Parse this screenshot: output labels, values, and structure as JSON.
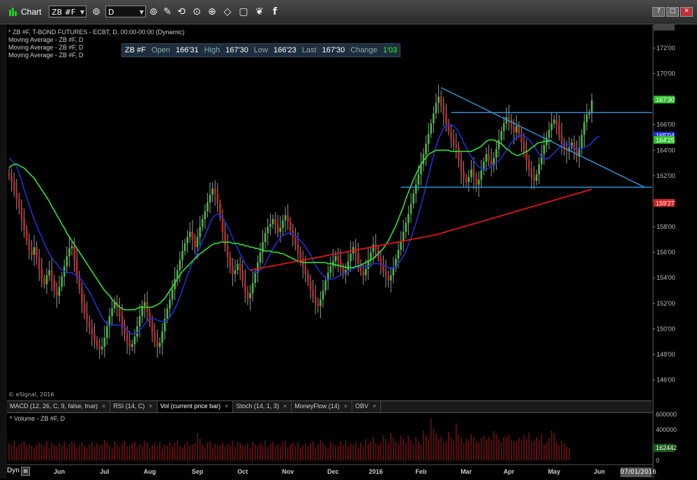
{
  "window": {
    "title": "Chart",
    "symbol": "ZB #F",
    "interval": "D"
  },
  "info_lines": [
    "* ZB #F, T-BOND FUTURES - ECBT, D, 00:00-00:00 (Dynamic)",
    "Moving Average - ZB #F, D",
    "Moving Average - ZB #F, D",
    "Moving Average - ZB #F, D"
  ],
  "quote": {
    "symbol": "ZB #F",
    "open_label": "Open",
    "open": "166'31",
    "high_label": "High",
    "high": "167'30",
    "low_label": "Low",
    "low": "166'23",
    "last_label": "Last",
    "last": "167'30",
    "change_label": "Change",
    "change": "1'03"
  },
  "copyright": "© eSignal, 2016",
  "tabs": [
    {
      "label": "MACD (12, 26, C, 9, false, true)"
    },
    {
      "label": "RSI (14, C)"
    },
    {
      "label": "Vol (current price bar)"
    },
    {
      "label": "Stoch (14, 1, 3)"
    },
    {
      "label": "MoneyFlow (14)"
    },
    {
      "label": "OBV"
    }
  ],
  "volume_label": "* Volume - ZB #F, D",
  "footer": {
    "dyn": "Dyn",
    "date": "07/01/2016"
  },
  "colors": {
    "up": "#3fbf3f",
    "down": "#d02020",
    "ma_fast": "#2030d0",
    "ma_mid": "#30e030",
    "ma_slow": "#e01515",
    "trend": "#2d9ae0",
    "volume": "#5a1010"
  },
  "chart_data": [
    {
      "type": "candlestick",
      "title": "ZB #F, T-BOND FUTURES - ECBT, D",
      "x_ticks": [
        "Jun",
        "Jul",
        "Aug",
        "Sep",
        "Oct",
        "Nov",
        "Dec",
        "2016",
        "Feb",
        "Mar",
        "Apr",
        "May",
        "Jun"
      ],
      "y_ticks": [
        "173'21",
        "172'00",
        "170'00",
        "168'00",
        "166'00",
        "164'00",
        "162'00",
        "160'00",
        "158'00",
        "156'00",
        "154'00",
        "152'00",
        "150'00",
        "148'00",
        "146'00"
      ],
      "ylim": [
        144.5,
        173.8
      ],
      "price_labels": [
        {
          "text": "167'30",
          "value": 167.94,
          "color": "#30c030"
        },
        {
          "text": "165'04",
          "value": 165.125,
          "color": "#2030d0"
        },
        {
          "text": "164'25",
          "value": 164.78,
          "color": "#30c030"
        },
        {
          "text": "159'27",
          "value": 159.84,
          "color": "#d02020"
        }
      ],
      "closes": [
        162.0,
        161.5,
        160.8,
        160.2,
        159.5,
        158.6,
        157.8,
        156.9,
        156.2,
        155.8,
        156.4,
        155.6,
        154.7,
        153.9,
        153.5,
        154.2,
        154.6,
        153.8,
        153.0,
        152.6,
        153.3,
        154.1,
        154.9,
        155.7,
        156.3,
        156.5,
        155.4,
        154.2,
        153.1,
        152.0,
        151.2,
        150.6,
        150.1,
        149.6,
        149.1,
        148.7,
        148.4,
        148.6,
        149.3,
        150.2,
        151.0,
        151.6,
        152.1,
        151.7,
        151.0,
        150.3,
        149.6,
        149.0,
        148.6,
        148.8,
        149.4,
        150.2,
        151.0,
        151.8,
        152.1,
        151.3,
        150.5,
        149.7,
        149.0,
        148.6,
        148.9,
        149.8,
        150.8,
        151.6,
        152.3,
        153.1,
        153.9,
        154.6,
        155.4,
        156.1,
        156.7,
        157.2,
        157.6,
        157.0,
        156.4,
        157.2,
        158.0,
        158.6,
        159.2,
        159.9,
        160.5,
        161.0,
        160.6,
        159.8,
        158.8,
        157.6,
        156.5,
        155.6,
        154.9,
        154.3,
        154.6,
        155.1,
        154.6,
        153.7,
        152.9,
        152.4,
        152.8,
        153.6,
        154.4,
        155.2,
        156.0,
        156.8,
        157.5,
        158.0,
        158.2,
        158.6,
        158.2,
        157.6,
        157.9,
        158.5,
        158.9,
        158.4,
        157.7,
        157.2,
        156.6,
        156.0,
        155.5,
        154.9,
        154.3,
        153.7,
        153.1,
        152.5,
        152.0,
        151.8,
        152.3,
        153.0,
        153.8,
        154.4,
        154.9,
        155.3,
        155.7,
        155.4,
        154.8,
        154.3,
        154.6,
        155.3,
        155.9,
        156.4,
        155.9,
        155.1,
        154.5,
        154.2,
        154.7,
        155.4,
        156.0,
        156.6,
        156.2,
        155.6,
        155.0,
        154.5,
        154.1,
        153.8,
        154.2,
        154.8,
        155.5,
        156.2,
        156.9,
        157.6,
        158.3,
        159.0,
        159.8,
        160.6,
        161.3,
        162.1,
        162.9,
        163.7,
        164.5,
        165.3,
        166.1,
        166.9,
        167.7,
        168.2,
        167.5,
        166.8,
        166.1,
        165.5,
        164.9,
        164.4,
        164.2,
        163.2,
        162.3,
        161.8,
        161.5,
        161.9,
        162.5,
        161.8,
        161.3,
        161.7,
        162.4,
        163.1,
        163.7,
        163.2,
        162.8,
        163.4,
        164.1,
        164.8,
        165.5,
        166.1,
        166.6,
        166.4,
        165.8,
        165.4,
        165.9,
        165.3,
        164.6,
        163.9,
        163.2,
        162.5,
        161.9,
        161.6,
        162.1,
        162.9,
        163.7,
        164.4,
        165.0,
        165.6,
        166.1,
        166.4,
        166.0,
        165.2,
        164.5,
        164.1,
        163.9,
        164.2,
        164.6,
        164.0,
        163.5,
        164.2,
        165.2,
        166.2,
        166.8,
        166.9,
        167.9
      ],
      "ma_fast": [
        163.4,
        163.2,
        163.0,
        162.7,
        162.2,
        161.6,
        160.9,
        160.3,
        159.7,
        159.1,
        158.6,
        158.1,
        157.6,
        157.2,
        156.7,
        156.3,
        155.9,
        155.6,
        155.3,
        155.1,
        154.8,
        154.6,
        154.5,
        154.4,
        154.4,
        154.4,
        154.3,
        154.1,
        154.0,
        153.8,
        153.5,
        153.2,
        152.9,
        152.5,
        152.1,
        151.7,
        151.3,
        150.9,
        150.6,
        150.4,
        150.3,
        150.3,
        150.3,
        150.3,
        150.3,
        150.2,
        150.1,
        149.9,
        149.7,
        149.6,
        149.6,
        149.7,
        149.9,
        150.1,
        150.4,
        150.6,
        150.8,
        150.8,
        150.8,
        150.7,
        150.6,
        150.6,
        150.6,
        150.7,
        150.9,
        151.2,
        151.6,
        152.0,
        152.5,
        153.1,
        153.6,
        154.2,
        154.7,
        155.2,
        155.6,
        156.0,
        156.4,
        156.9,
        157.3,
        157.8,
        158.3,
        158.7,
        158.9,
        159.0,
        158.9,
        158.7,
        158.4,
        158.0,
        157.6,
        157.1,
        156.7,
        156.3,
        155.9,
        155.5,
        155.1,
        154.8,
        154.6,
        154.5,
        154.4,
        154.5,
        154.6,
        154.8,
        155.1,
        155.5,
        155.9,
        156.3,
        156.6,
        156.9,
        157.1,
        157.3,
        157.4,
        157.5,
        157.5,
        157.4,
        157.3,
        157.1,
        156.9,
        156.7,
        156.4,
        156.1,
        155.8,
        155.4,
        155.0,
        154.7,
        154.4,
        154.2,
        154.0,
        153.9,
        153.9,
        153.9,
        154.0,
        154.1,
        154.2,
        154.3,
        154.4,
        154.5,
        154.6,
        154.7,
        154.8,
        154.8,
        154.9,
        154.9,
        154.9,
        154.9,
        155.0,
        155.1,
        155.1,
        155.1,
        155.1,
        155.0,
        154.9,
        154.8,
        154.7,
        154.8,
        154.9,
        155.1,
        155.4,
        155.7,
        156.1,
        156.6,
        157.1,
        157.7,
        158.3,
        159.0,
        159.7,
        160.4,
        161.2,
        162.0,
        162.8,
        163.6,
        164.3,
        164.9,
        165.3,
        165.7,
        165.9,
        166.0,
        166.0,
        165.9,
        165.7,
        165.4,
        165.0,
        164.6,
        164.2,
        163.8,
        163.5,
        163.2,
        162.9,
        162.7,
        162.6,
        162.5,
        162.5,
        162.6,
        162.8,
        162.9,
        163.0,
        163.2,
        163.4,
        163.7,
        164.0,
        164.3,
        164.6,
        164.8,
        165.0,
        165.1,
        165.2,
        165.1,
        165.0,
        164.8,
        164.6,
        164.3,
        164.0,
        163.7,
        163.5,
        163.4,
        163.3,
        163.4,
        163.6,
        163.8,
        164.0,
        164.2,
        164.4,
        164.5,
        164.5,
        164.4,
        164.3,
        164.2,
        164.1,
        164.1,
        164.1,
        164.2,
        164.3,
        164.4,
        164.6,
        164.8,
        165.0,
        165.1
      ],
      "ma_mid": [
        162.6,
        162.8,
        162.9,
        162.9,
        162.8,
        162.7,
        162.6,
        162.4,
        162.2,
        162.0,
        161.8,
        161.5,
        161.2,
        160.9,
        160.6,
        160.3,
        160.0,
        159.6,
        159.3,
        158.9,
        158.6,
        158.2,
        157.9,
        157.5,
        157.2,
        156.9,
        156.6,
        156.3,
        156.0,
        155.7,
        155.4,
        155.1,
        154.8,
        154.5,
        154.2,
        153.9,
        153.6,
        153.3,
        153.0,
        152.8,
        152.6,
        152.3,
        152.1,
        151.9,
        151.7,
        151.6,
        151.5,
        151.5,
        151.5,
        151.5,
        151.5,
        151.6,
        151.7,
        151.7,
        151.7,
        151.7,
        151.7,
        151.7,
        151.8,
        151.9,
        152.0,
        152.2,
        152.4,
        152.7,
        153.0,
        153.3,
        153.6,
        153.9,
        154.2,
        154.5,
        154.7,
        154.9,
        155.1,
        155.3,
        155.5,
        155.7,
        155.9,
        156.0,
        156.2,
        156.3,
        156.5,
        156.6,
        156.7,
        156.7,
        156.8,
        156.8,
        156.8,
        156.8,
        156.8,
        156.7,
        156.7,
        156.7,
        156.6,
        156.6,
        156.5,
        156.5,
        156.4,
        156.4,
        156.3,
        156.3,
        156.2,
        156.2,
        156.1,
        156.1,
        156.1,
        156.0,
        156.0,
        156.0,
        155.9,
        155.9,
        155.8,
        155.7,
        155.6,
        155.5,
        155.4,
        155.3,
        155.3,
        155.2,
        155.2,
        155.2,
        155.2,
        155.2,
        155.2,
        155.2,
        155.2,
        155.2,
        155.2,
        155.1,
        155.1,
        155.1,
        155.0,
        155.0,
        154.9,
        154.9,
        154.8,
        154.8,
        154.8,
        154.8,
        154.9,
        154.9,
        155.0,
        155.1,
        155.2,
        155.3,
        155.4,
        155.5,
        155.7,
        155.9,
        156.1,
        156.3,
        156.6,
        156.9,
        157.3,
        157.7,
        158.1,
        158.6,
        159.1,
        159.6,
        160.2,
        160.7,
        161.2,
        161.7,
        162.1,
        162.5,
        162.9,
        163.2,
        163.4,
        163.7,
        163.8,
        163.9,
        164.0,
        164.0,
        164.0,
        164.0,
        164.0,
        164.0,
        163.9,
        163.9,
        163.9,
        163.9,
        163.9,
        163.9,
        163.9,
        163.9,
        163.9,
        164.0,
        164.1,
        164.2,
        164.3,
        164.5,
        164.7,
        164.8,
        164.8,
        164.8,
        164.7,
        164.6,
        164.5,
        164.3,
        164.1,
        164.0,
        163.8,
        163.7,
        163.6,
        163.6,
        163.7,
        163.8,
        163.9,
        164.0,
        164.2,
        164.3,
        164.5,
        164.6,
        164.6,
        164.7,
        164.7,
        164.7,
        164.8
      ]
    },
    {
      "type": "bar",
      "title": "Volume - ZB #F, D",
      "y_ticks": [
        "600000",
        "400000",
        "162442",
        "0"
      ],
      "ylim": [
        0,
        600000
      ],
      "last_value": 162442,
      "values": [
        226000,
        198000,
        262000,
        173000,
        205000,
        230000,
        246000,
        183000,
        212000,
        190000,
        156000,
        202000,
        238000,
        217000,
        186000,
        249000,
        164000,
        231000,
        203000,
        187000,
        225000,
        196000,
        241000,
        172000,
        215000,
        247000,
        227000,
        161000,
        199000,
        233000,
        185000,
        159000,
        211000,
        243000,
        178000,
        222000,
        194000,
        207000,
        263000,
        231000,
        190000,
        155000,
        247000,
        203000,
        171000,
        218000,
        255000,
        184000,
        196000,
        229000,
        244000,
        176000,
        209000,
        190000,
        260000,
        235000,
        170000,
        201000,
        227000,
        183000,
        246000,
        152000,
        214000,
        196000,
        239000,
        178000,
        223000,
        264000,
        195000,
        161000,
        212000,
        241000,
        189000,
        207000,
        228000,
        356000,
        284000,
        204000,
        176000,
        238000,
        249000,
        168000,
        221000,
        192000,
        202000,
        234000,
        182000,
        214000,
        196000,
        257000,
        173000,
        240000,
        227000,
        188000,
        200000,
        230000,
        166000,
        244000,
        210000,
        198000,
        225000,
        186000,
        258000,
        171000,
        216000,
        240000,
        193000,
        204000,
        183000,
        234000,
        251000,
        176000,
        212000,
        229000,
        189000,
        242000,
        168000,
        197000,
        231000,
        185000,
        221000,
        245000,
        162000,
        208000,
        273000,
        233000,
        190000,
        156000,
        241000,
        215000,
        197000,
        185000,
        246000,
        202000,
        269000,
        181000,
        225000,
        204000,
        243000,
        160000,
        238000,
        191000,
        282000,
        217000,
        250000,
        306000,
        227000,
        199000,
        240000,
        331000,
        280000,
        216000,
        356000,
        298000,
        240000,
        208000,
        325000,
        284000,
        235000,
        318000,
        264000,
        226000,
        300000,
        245000,
        212000,
        389000,
        330000,
        284000,
        541000,
        420000,
        356000,
        275000,
        310000,
        236000,
        254000,
        377000,
        303000,
        260000,
        483000,
        337000,
        297000,
        228000,
        283000,
        261000,
        344000,
        304000,
        246000,
        232000,
        286000,
        324000,
        275000,
        305000,
        262000,
        383000,
        339000,
        279000,
        237000,
        314000,
        301000,
        326000,
        268000,
        252000,
        243000,
        297000,
        276000,
        332000,
        284000,
        364000,
        243000,
        258000,
        301000,
        276000,
        348000,
        214000,
        243000,
        290000,
        392000,
        355000,
        243000,
        202000,
        256000,
        224000,
        182000,
        162000
      ]
    }
  ]
}
